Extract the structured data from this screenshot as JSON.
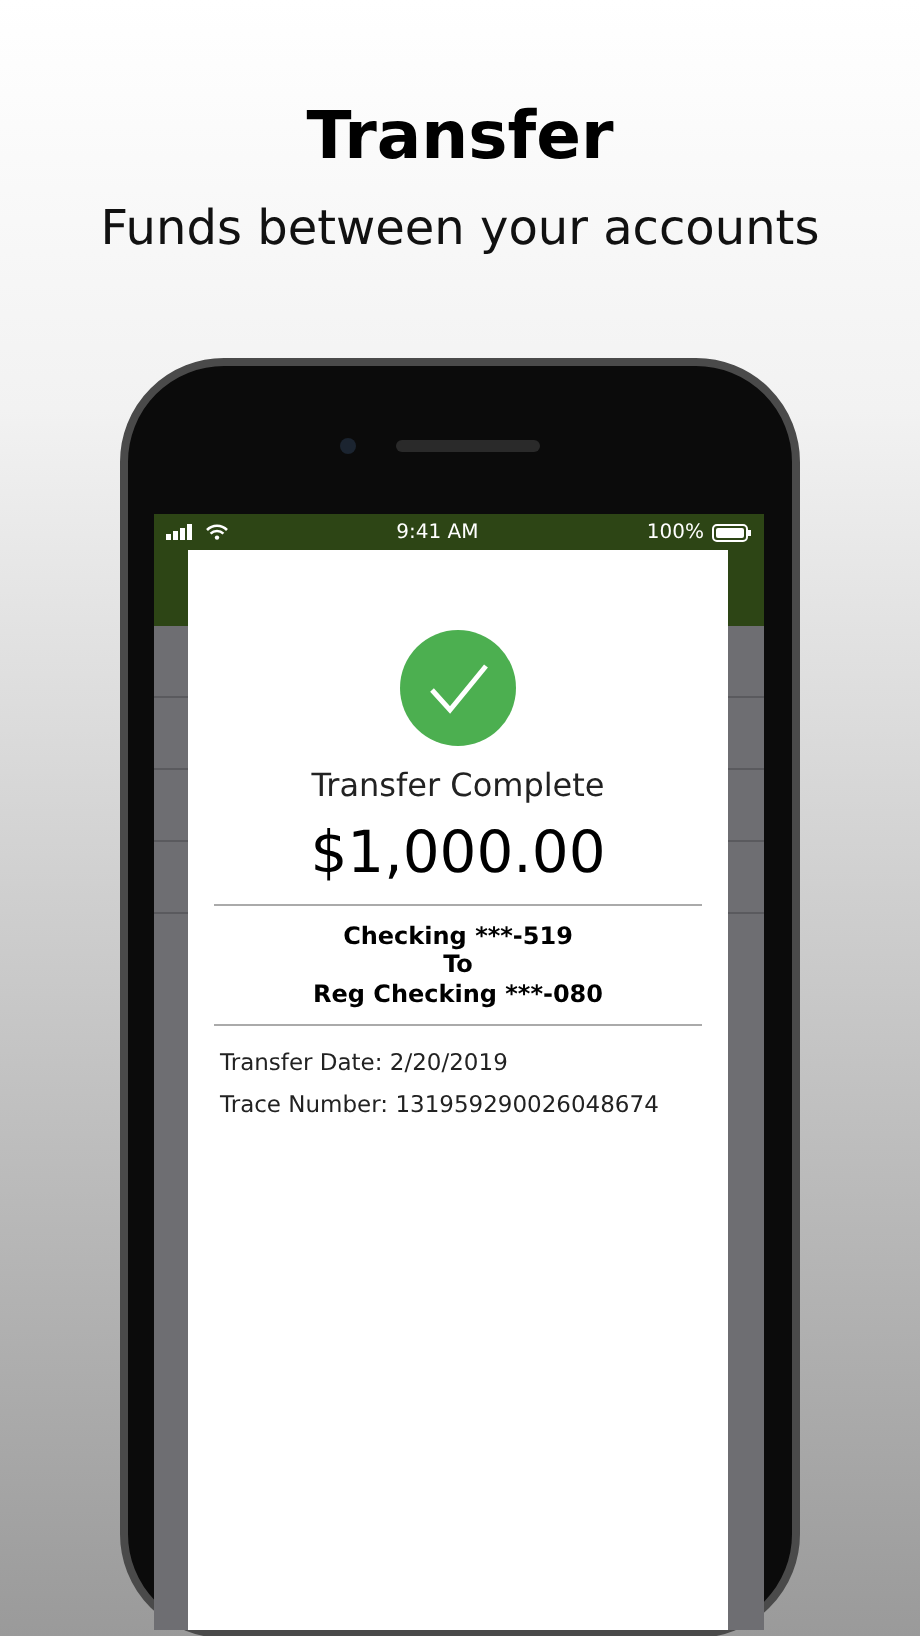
{
  "headline": "Transfer",
  "subtitle": "Funds between your accounts",
  "status_bar": {
    "time": "9:41 AM",
    "battery": "100%"
  },
  "receipt": {
    "status": "Transfer Complete",
    "amount": "$1,000.00",
    "route": [
      "Checking ***-519",
      "To",
      "Reg Checking ***-080"
    ],
    "details": [
      "Transfer Date: 2/20/2019",
      "Trace Number: 131959290026048674"
    ]
  }
}
